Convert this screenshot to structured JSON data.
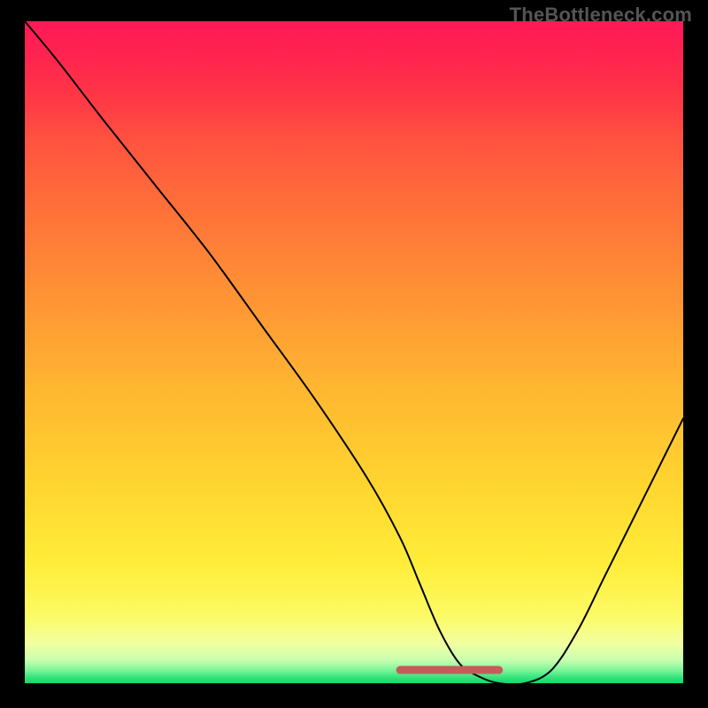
{
  "watermark": "TheBottleneck.com",
  "chart_data": {
    "type": "line",
    "title": "",
    "subtitle": "",
    "xlabel": "",
    "ylabel": "",
    "xlim": [
      0,
      100
    ],
    "ylim": [
      0,
      100
    ],
    "grid": false,
    "legend": false,
    "x": [
      0,
      5,
      12,
      20,
      28,
      36,
      44,
      52,
      57,
      60,
      63,
      66,
      69,
      72,
      76,
      80,
      84,
      88,
      92,
      96,
      100
    ],
    "values": [
      100,
      94,
      85,
      75,
      65,
      54,
      43,
      31,
      22,
      15,
      8,
      3,
      1,
      0,
      0,
      2,
      8,
      16,
      24,
      32,
      40
    ],
    "interval": {
      "x_start": 57,
      "x_end": 72,
      "y": 2
    },
    "colors": {
      "curve": "#000000",
      "interval": "#c85a5a",
      "top": "#ff1f4b",
      "bottom": "#13d968"
    },
    "description": "V-shaped bottleneck curve on a vertical heat gradient (red top = high bottleneck, green bottom = low). Flat red segment marks the range where bottleneck is effectively zero."
  }
}
